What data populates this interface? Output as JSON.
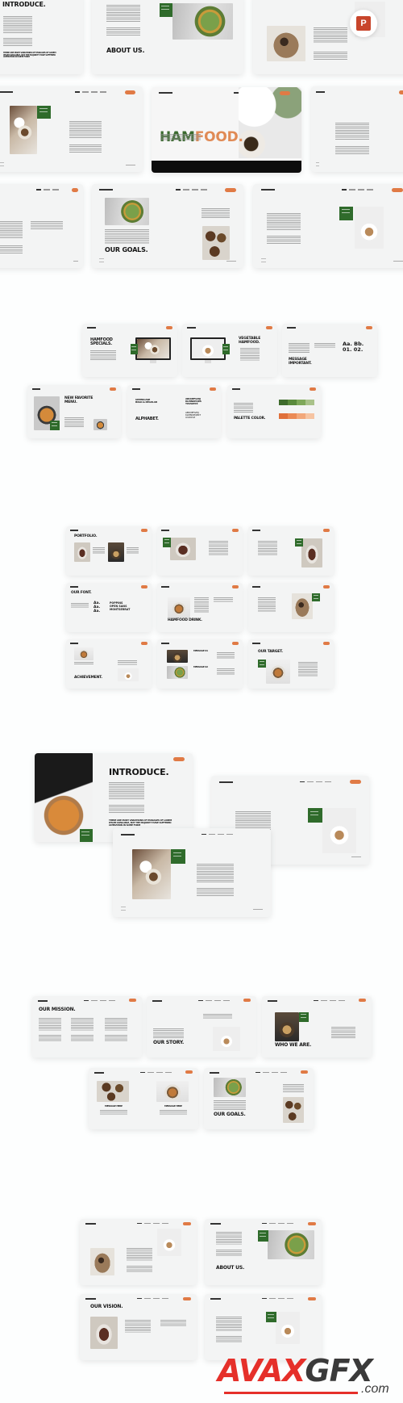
{
  "template": {
    "brand_main": "HAM",
    "brand_accent": "FOOD.",
    "colors": {
      "accent": "#e07a45",
      "green": "#2f6b2b",
      "dark": "#151515",
      "background": "#fdfefe"
    }
  },
  "slides": {
    "introduce_top": {
      "title": "INTRODUCE.",
      "note": "THERE ARE MANY VARIATIONS OF PASSAGES OF LOREM IPSUM AVAILABLE, BUT THE MAJORITY HAVE SUFFERED ALTERATION IN SOME FORM"
    },
    "about_top": {
      "title": "ABOUT US."
    },
    "cover": {
      "title_main": "HAM",
      "title_accent": "FOOD."
    },
    "goals_top": {
      "title": "OUR GOALS."
    },
    "specials": {
      "title": "HAMFOOD\nSPECIALS."
    },
    "vegetable": {
      "title": "VEGETABLE\nHAMFOOD."
    },
    "message": {
      "title": "MESSAGE\nIMPORTANT.",
      "glyphs": "Aa.  Bb.\n01.  02."
    },
    "favorite_menu": {
      "title": "NEW FAVORITE\nMENU."
    },
    "alphabet": {
      "subtitle": "UPPERCASE\nBOLD & REGULAR",
      "title": "ALPHABET.",
      "upper": "ABCDEFGHIJ\nKLMNOPQRS\nTUVWXYZ",
      "lower": "ABCDEFGHIJ\nKLMNOPQRST\nUVWXYZ"
    },
    "palette": {
      "title": "PALETTE COLOR.",
      "greens": [
        "#3e6b2c",
        "#5a8a3c",
        "#7fa85a",
        "#a9c28a"
      ],
      "oranges": [
        "#e0703a",
        "#eb8a55",
        "#f2a77a",
        "#f6c4a2"
      ]
    },
    "portfolio": {
      "title": "PORTFOLIO."
    },
    "font": {
      "title": "OUR FONT.",
      "samples": "Aa.\nAa.\nAa.",
      "names": "POPPINS\nOPEN SANS\nMONTSERRAT"
    },
    "drink": {
      "title": "HAMFOOD DRINK."
    },
    "achievement": {
      "title": "ACHIEVEMENT."
    },
    "messages": {
      "first": "MESSAGE 01",
      "second": "MESSAGE 02"
    },
    "target": {
      "title": "OUR TARGET."
    },
    "introduce_big": {
      "title": "INTRODUCE.",
      "note": "THERE ARE MANY VARIATIONS OF PASSAGES OF LOREM IPSUM AVAILABLE, BUT THE MAJORITY HAVE SUFFERED ALTERATION IN SOME FORM"
    },
    "mission": {
      "title": "OUR MISSION."
    },
    "story": {
      "title": "OUR STORY."
    },
    "who": {
      "title": "WHO WE ARE."
    },
    "message_here": {
      "left": "MESSAGE HERE",
      "right": "MESSAGE HERE"
    },
    "goals_bottom": {
      "title": "OUR GOALS."
    },
    "about_bottom": {
      "title": "ABOUT US."
    },
    "vision": {
      "title": "OUR VISION."
    }
  },
  "badge": {
    "icon": "powerpoint-icon",
    "letter": "P"
  },
  "watermark": {
    "red": "AVAX",
    "gray": "GFX",
    "suffix": ".com"
  }
}
